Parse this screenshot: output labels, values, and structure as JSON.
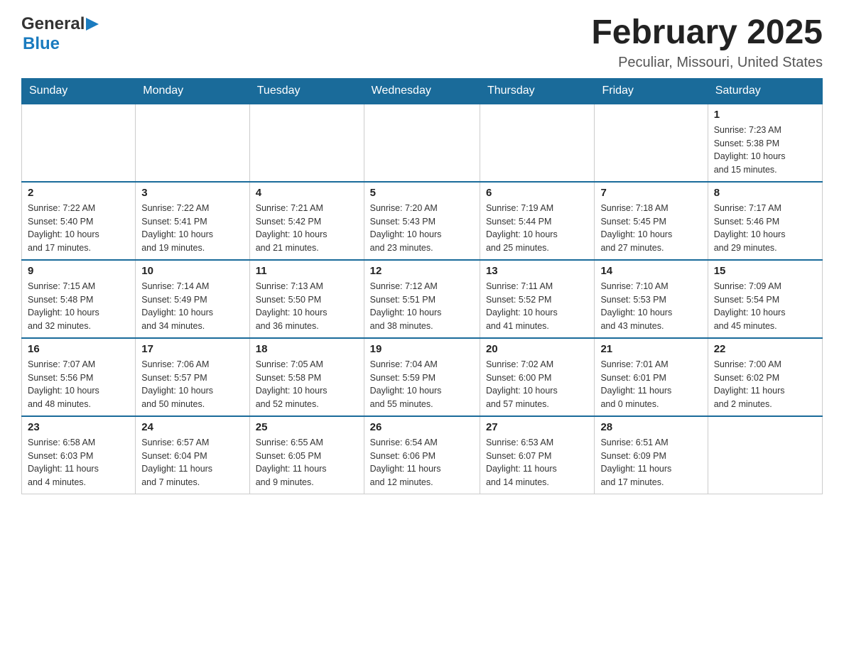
{
  "header": {
    "logo_general": "General",
    "logo_blue": "Blue",
    "month_title": "February 2025",
    "location": "Peculiar, Missouri, United States"
  },
  "days_of_week": [
    "Sunday",
    "Monday",
    "Tuesday",
    "Wednesday",
    "Thursday",
    "Friday",
    "Saturday"
  ],
  "weeks": [
    [
      {
        "day": "",
        "info": ""
      },
      {
        "day": "",
        "info": ""
      },
      {
        "day": "",
        "info": ""
      },
      {
        "day": "",
        "info": ""
      },
      {
        "day": "",
        "info": ""
      },
      {
        "day": "",
        "info": ""
      },
      {
        "day": "1",
        "info": "Sunrise: 7:23 AM\nSunset: 5:38 PM\nDaylight: 10 hours\nand 15 minutes."
      }
    ],
    [
      {
        "day": "2",
        "info": "Sunrise: 7:22 AM\nSunset: 5:40 PM\nDaylight: 10 hours\nand 17 minutes."
      },
      {
        "day": "3",
        "info": "Sunrise: 7:22 AM\nSunset: 5:41 PM\nDaylight: 10 hours\nand 19 minutes."
      },
      {
        "day": "4",
        "info": "Sunrise: 7:21 AM\nSunset: 5:42 PM\nDaylight: 10 hours\nand 21 minutes."
      },
      {
        "day": "5",
        "info": "Sunrise: 7:20 AM\nSunset: 5:43 PM\nDaylight: 10 hours\nand 23 minutes."
      },
      {
        "day": "6",
        "info": "Sunrise: 7:19 AM\nSunset: 5:44 PM\nDaylight: 10 hours\nand 25 minutes."
      },
      {
        "day": "7",
        "info": "Sunrise: 7:18 AM\nSunset: 5:45 PM\nDaylight: 10 hours\nand 27 minutes."
      },
      {
        "day": "8",
        "info": "Sunrise: 7:17 AM\nSunset: 5:46 PM\nDaylight: 10 hours\nand 29 minutes."
      }
    ],
    [
      {
        "day": "9",
        "info": "Sunrise: 7:15 AM\nSunset: 5:48 PM\nDaylight: 10 hours\nand 32 minutes."
      },
      {
        "day": "10",
        "info": "Sunrise: 7:14 AM\nSunset: 5:49 PM\nDaylight: 10 hours\nand 34 minutes."
      },
      {
        "day": "11",
        "info": "Sunrise: 7:13 AM\nSunset: 5:50 PM\nDaylight: 10 hours\nand 36 minutes."
      },
      {
        "day": "12",
        "info": "Sunrise: 7:12 AM\nSunset: 5:51 PM\nDaylight: 10 hours\nand 38 minutes."
      },
      {
        "day": "13",
        "info": "Sunrise: 7:11 AM\nSunset: 5:52 PM\nDaylight: 10 hours\nand 41 minutes."
      },
      {
        "day": "14",
        "info": "Sunrise: 7:10 AM\nSunset: 5:53 PM\nDaylight: 10 hours\nand 43 minutes."
      },
      {
        "day": "15",
        "info": "Sunrise: 7:09 AM\nSunset: 5:54 PM\nDaylight: 10 hours\nand 45 minutes."
      }
    ],
    [
      {
        "day": "16",
        "info": "Sunrise: 7:07 AM\nSunset: 5:56 PM\nDaylight: 10 hours\nand 48 minutes."
      },
      {
        "day": "17",
        "info": "Sunrise: 7:06 AM\nSunset: 5:57 PM\nDaylight: 10 hours\nand 50 minutes."
      },
      {
        "day": "18",
        "info": "Sunrise: 7:05 AM\nSunset: 5:58 PM\nDaylight: 10 hours\nand 52 minutes."
      },
      {
        "day": "19",
        "info": "Sunrise: 7:04 AM\nSunset: 5:59 PM\nDaylight: 10 hours\nand 55 minutes."
      },
      {
        "day": "20",
        "info": "Sunrise: 7:02 AM\nSunset: 6:00 PM\nDaylight: 10 hours\nand 57 minutes."
      },
      {
        "day": "21",
        "info": "Sunrise: 7:01 AM\nSunset: 6:01 PM\nDaylight: 11 hours\nand 0 minutes."
      },
      {
        "day": "22",
        "info": "Sunrise: 7:00 AM\nSunset: 6:02 PM\nDaylight: 11 hours\nand 2 minutes."
      }
    ],
    [
      {
        "day": "23",
        "info": "Sunrise: 6:58 AM\nSunset: 6:03 PM\nDaylight: 11 hours\nand 4 minutes."
      },
      {
        "day": "24",
        "info": "Sunrise: 6:57 AM\nSunset: 6:04 PM\nDaylight: 11 hours\nand 7 minutes."
      },
      {
        "day": "25",
        "info": "Sunrise: 6:55 AM\nSunset: 6:05 PM\nDaylight: 11 hours\nand 9 minutes."
      },
      {
        "day": "26",
        "info": "Sunrise: 6:54 AM\nSunset: 6:06 PM\nDaylight: 11 hours\nand 12 minutes."
      },
      {
        "day": "27",
        "info": "Sunrise: 6:53 AM\nSunset: 6:07 PM\nDaylight: 11 hours\nand 14 minutes."
      },
      {
        "day": "28",
        "info": "Sunrise: 6:51 AM\nSunset: 6:09 PM\nDaylight: 11 hours\nand 17 minutes."
      },
      {
        "day": "",
        "info": ""
      }
    ]
  ]
}
